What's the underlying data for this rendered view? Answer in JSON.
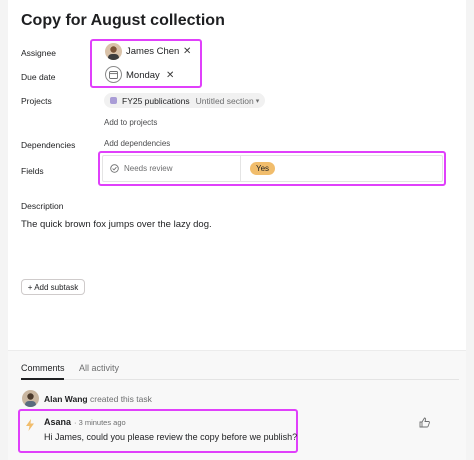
{
  "task": {
    "title": "Copy for August collection",
    "assignee": {
      "label": "Assignee",
      "name": "James Chen"
    },
    "due_date": {
      "label": "Due date",
      "value": "Monday"
    },
    "projects": {
      "label": "Projects",
      "project_name": "FY25 publications",
      "section": "Untitled section",
      "add_link": "Add to projects",
      "project_color": "#a99cd6"
    },
    "dependencies": {
      "label": "Dependencies",
      "add_link": "Add dependencies"
    },
    "fields": {
      "label": "Fields",
      "name": "Needs review",
      "value": "Yes",
      "value_color": "#f1bd6c"
    },
    "description": {
      "label": "Description",
      "text": "The quick brown fox jumps over the lazy dog."
    },
    "add_subtask": "+ Add subtask"
  },
  "footer": {
    "tabs": [
      "Comments",
      "All activity"
    ],
    "activity": {
      "user": "Alan Wang",
      "action": "created this task"
    },
    "comment": {
      "author": "Asana",
      "time": "· 3 minutes ago",
      "text": "Hi James, could you please review the copy before we publish?"
    }
  },
  "icons": {
    "assignee_remove": "close-icon",
    "due_remove": "close-icon",
    "calendar": "calendar-icon",
    "needs_review": "check-circle-icon",
    "comment_like": "thumbs-up-icon",
    "asana_bolt": "lightning-icon"
  },
  "colors": {
    "highlight": "#e040fb"
  }
}
